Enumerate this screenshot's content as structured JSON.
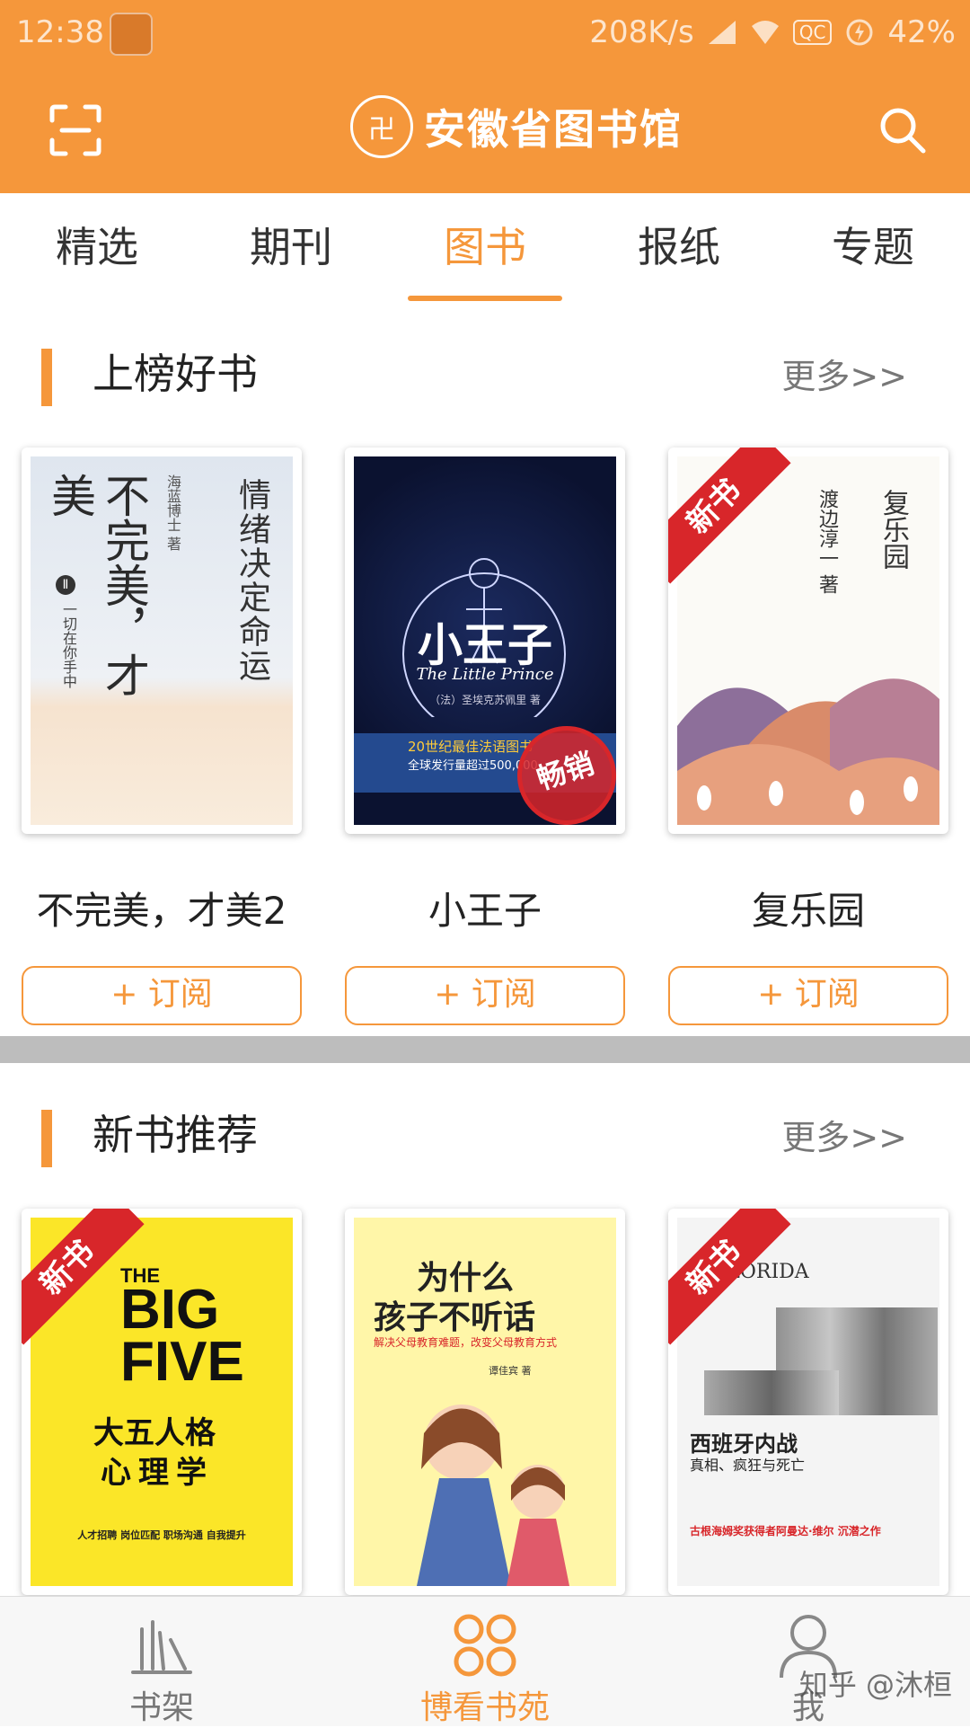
{
  "status_bar": {
    "time": "12:38",
    "speed": "208K/s",
    "qc": "QC",
    "battery": "42%"
  },
  "header": {
    "logo_text": "安徽省图书馆",
    "seal_text": "卍",
    "scan_icon": "scan-icon",
    "search_icon": "search-icon",
    "bg_color": "#f5973b"
  },
  "tabs": [
    {
      "label": "精选",
      "active": false
    },
    {
      "label": "期刊",
      "active": false
    },
    {
      "label": "图书",
      "active": true
    },
    {
      "label": "报纸",
      "active": false
    },
    {
      "label": "专题",
      "active": false
    }
  ],
  "section_top": {
    "title": "上榜好书",
    "more": "更多>>",
    "books": [
      {
        "title": "不完美，才美2",
        "subscribe": "+ 订阅",
        "cover": {
          "big": "不完美，才美",
          "sub": "情绪决定命运",
          "vol": "Ⅱ",
          "note": "一切在你手中",
          "author": "海蓝博士 著"
        }
      },
      {
        "title": "小王子",
        "subscribe": "+ 订阅",
        "cover": {
          "big": "小王子",
          "en": "The Little Prince",
          "author": "（法）圣埃克苏佩里 著",
          "band": "20世纪最佳法语图书",
          "band2": "全球发行量超过500,000",
          "stamp": "畅销"
        }
      },
      {
        "title": "复乐园",
        "subscribe": "+ 订阅",
        "cover": {
          "big": "复乐园",
          "author": "渡边淳一 著",
          "ribbon": "新书"
        }
      }
    ]
  },
  "section_new": {
    "title": "新书推荐",
    "more": "更多>>",
    "books": [
      {
        "cover": {
          "line1": "THE",
          "line2": "BIG",
          "line3": "FIVE",
          "cn": "大五人格",
          "cn2": "心理学",
          "foot": "人才招聘  岗位匹配  职场沟通  自我提升",
          "ribbon": "新书"
        }
      },
      {
        "cover": {
          "cn": "为什么",
          "cn2": "孩子不听话",
          "sub": "解决父母教育难题，改变父母教育方式",
          "author": "谭佳宾 著"
        }
      },
      {
        "cover": {
          "en": "EL FLORIDA",
          "cn": "西班牙内战",
          "cn2": "真相、疯狂与死亡",
          "foot": "古根海姆奖获得者阿曼达·维尔 沉潜之作",
          "ribbon": "新书"
        }
      }
    ]
  },
  "bottom_nav": [
    {
      "label": "书架",
      "icon": "bookshelf-icon",
      "active": false
    },
    {
      "label": "博看书苑",
      "icon": "clover-icon",
      "active": true
    },
    {
      "label": "我",
      "icon": "person-icon",
      "active": false
    }
  ],
  "watermark": "知乎 @沐桓"
}
